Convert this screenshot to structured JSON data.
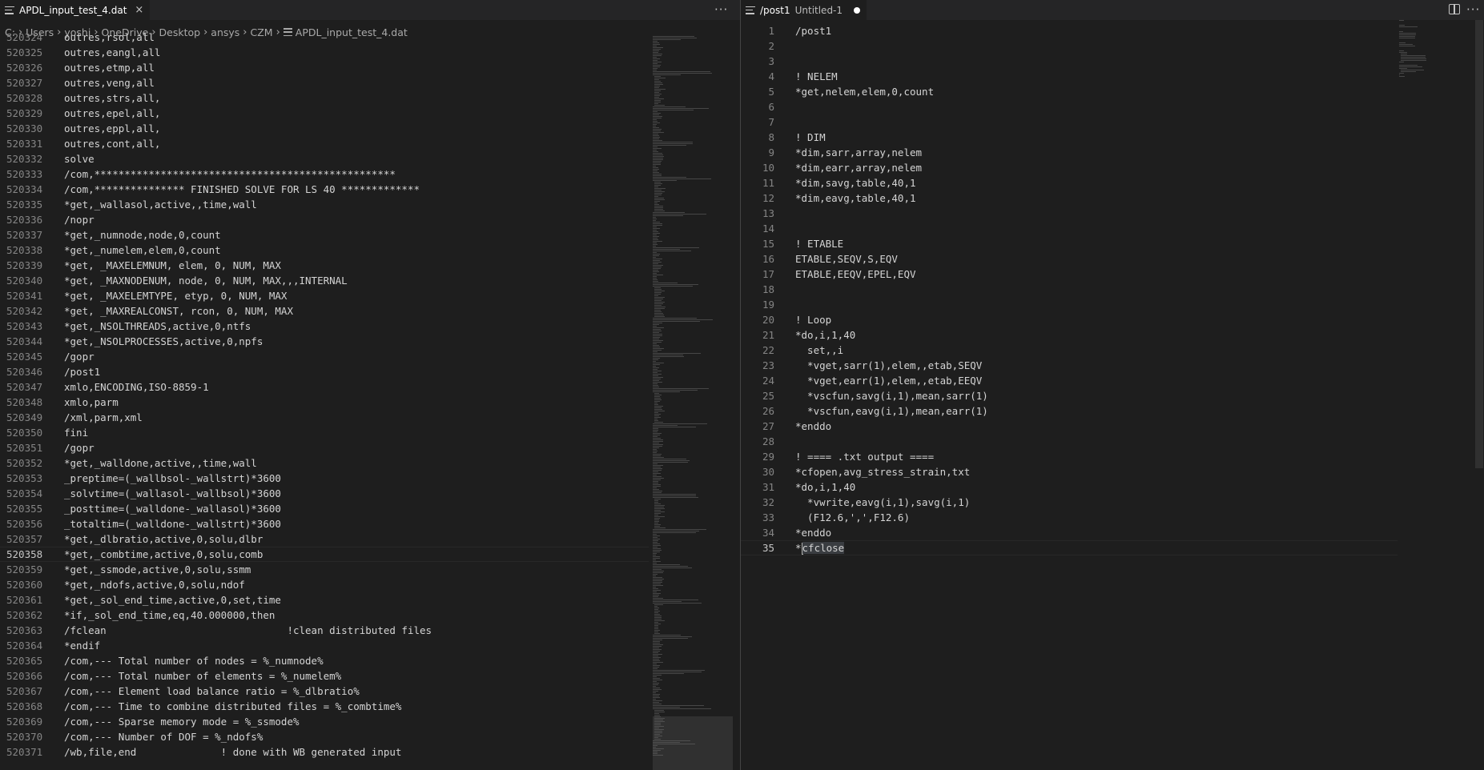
{
  "left": {
    "tab": {
      "title": "APDL_input_test_4.dat",
      "close": "×"
    },
    "more": "···",
    "breadcrumb": [
      "C:",
      "Users",
      "yoshi",
      "OneDrive",
      "Desktop",
      "ansys",
      "CZM",
      "APDL_input_test_4.dat"
    ],
    "lines": [
      {
        "n": "520324",
        "t": "outres,rsol,all"
      },
      {
        "n": "520325",
        "t": "outres,eangl,all"
      },
      {
        "n": "520326",
        "t": "outres,etmp,all"
      },
      {
        "n": "520327",
        "t": "outres,veng,all"
      },
      {
        "n": "520328",
        "t": "outres,strs,all,"
      },
      {
        "n": "520329",
        "t": "outres,epel,all,"
      },
      {
        "n": "520330",
        "t": "outres,eppl,all,"
      },
      {
        "n": "520331",
        "t": "outres,cont,all,"
      },
      {
        "n": "520332",
        "t": "solve"
      },
      {
        "n": "520333",
        "t": "/com,**************************************************"
      },
      {
        "n": "520334",
        "t": "/com,*************** FINISHED SOLVE FOR LS 40 *************"
      },
      {
        "n": "520335",
        "t": "*get,_wallasol,active,,time,wall"
      },
      {
        "n": "520336",
        "t": "/nopr"
      },
      {
        "n": "520337",
        "t": "*get,_numnode,node,0,count"
      },
      {
        "n": "520338",
        "t": "*get,_numelem,elem,0,count"
      },
      {
        "n": "520339",
        "t": "*get, _MAXELEMNUM, elem, 0, NUM, MAX"
      },
      {
        "n": "520340",
        "t": "*get, _MAXNODENUM, node, 0, NUM, MAX,,,INTERNAL"
      },
      {
        "n": "520341",
        "t": "*get, _MAXELEMTYPE, etyp, 0, NUM, MAX"
      },
      {
        "n": "520342",
        "t": "*get, _MAXREALCONST, rcon, 0, NUM, MAX"
      },
      {
        "n": "520343",
        "t": "*get,_NSOLTHREADS,active,0,ntfs"
      },
      {
        "n": "520344",
        "t": "*get,_NSOLPROCESSES,active,0,npfs"
      },
      {
        "n": "520345",
        "t": "/gopr"
      },
      {
        "n": "520346",
        "t": "/post1"
      },
      {
        "n": "520347",
        "t": "xmlo,ENCODING,ISO-8859-1"
      },
      {
        "n": "520348",
        "t": "xmlo,parm"
      },
      {
        "n": "520349",
        "t": "/xml,parm,xml"
      },
      {
        "n": "520350",
        "t": "fini"
      },
      {
        "n": "520351",
        "t": "/gopr"
      },
      {
        "n": "520352",
        "t": "*get,_walldone,active,,time,wall"
      },
      {
        "n": "520353",
        "t": "_preptime=(_wallbsol-_wallstrt)*3600"
      },
      {
        "n": "520354",
        "t": "_solvtime=(_wallasol-_wallbsol)*3600"
      },
      {
        "n": "520355",
        "t": "_posttime=(_walldone-_wallasol)*3600"
      },
      {
        "n": "520356",
        "t": "_totaltim=(_walldone-_wallstrt)*3600"
      },
      {
        "n": "520357",
        "t": "*get,_dlbratio,active,0,solu,dlbr"
      },
      {
        "n": "520358",
        "t": "*get,_combtime,active,0,solu,comb"
      },
      {
        "n": "520359",
        "t": "*get,_ssmode,active,0,solu,ssmm"
      },
      {
        "n": "520360",
        "t": "*get,_ndofs,active,0,solu,ndof"
      },
      {
        "n": "520361",
        "t": "*get,_sol_end_time,active,0,set,time"
      },
      {
        "n": "520362",
        "t": "*if,_sol_end_time,eq,40.000000,then"
      },
      {
        "n": "520363",
        "t": "/fclean                              !clean distributed files"
      },
      {
        "n": "520364",
        "t": "*endif"
      },
      {
        "n": "520365",
        "t": "/com,--- Total number of nodes = %_numnode%"
      },
      {
        "n": "520366",
        "t": "/com,--- Total number of elements = %_numelem%"
      },
      {
        "n": "520367",
        "t": "/com,--- Element load balance ratio = %_dlbratio%"
      },
      {
        "n": "520368",
        "t": "/com,--- Time to combine distributed files = %_combtime%"
      },
      {
        "n": "520369",
        "t": "/com,--- Sparse memory mode = %_ssmode%"
      },
      {
        "n": "520370",
        "t": "/com,--- Number of DOF = %_ndofs%"
      },
      {
        "n": "520371",
        "t": "/wb,file,end              ! done with WB generated input"
      }
    ]
  },
  "right": {
    "tab": {
      "title": "/post1",
      "subtitle": "Untitled-1"
    },
    "more": "···",
    "lines": [
      {
        "n": "1",
        "t": "/post1"
      },
      {
        "n": "2",
        "t": ""
      },
      {
        "n": "3",
        "t": ""
      },
      {
        "n": "4",
        "t": "! NELEM"
      },
      {
        "n": "5",
        "t": "*get,nelem,elem,0,count"
      },
      {
        "n": "6",
        "t": ""
      },
      {
        "n": "7",
        "t": ""
      },
      {
        "n": "8",
        "t": "! DIM"
      },
      {
        "n": "9",
        "t": "*dim,sarr,array,nelem"
      },
      {
        "n": "10",
        "t": "*dim,earr,array,nelem"
      },
      {
        "n": "11",
        "t": "*dim,savg,table,40,1"
      },
      {
        "n": "12",
        "t": "*dim,eavg,table,40,1"
      },
      {
        "n": "13",
        "t": ""
      },
      {
        "n": "14",
        "t": ""
      },
      {
        "n": "15",
        "t": "! ETABLE"
      },
      {
        "n": "16",
        "t": "ETABLE,SEQV,S,EQV"
      },
      {
        "n": "17",
        "t": "ETABLE,EEQV,EPEL,EQV"
      },
      {
        "n": "18",
        "t": ""
      },
      {
        "n": "19",
        "t": ""
      },
      {
        "n": "20",
        "t": "! Loop"
      },
      {
        "n": "21",
        "t": "*do,i,1,40"
      },
      {
        "n": "22",
        "t": "  set,,i"
      },
      {
        "n": "23",
        "t": "  *vget,sarr(1),elem,,etab,SEQV"
      },
      {
        "n": "24",
        "t": "  *vget,earr(1),elem,,etab,EEQV"
      },
      {
        "n": "25",
        "t": "  *vscfun,savg(i,1),mean,sarr(1)"
      },
      {
        "n": "26",
        "t": "  *vscfun,eavg(i,1),mean,earr(1)"
      },
      {
        "n": "27",
        "t": "*enddo"
      },
      {
        "n": "28",
        "t": ""
      },
      {
        "n": "29",
        "t": "! ==== .txt output ===="
      },
      {
        "n": "30",
        "t": "*cfopen,avg_stress_strain,txt"
      },
      {
        "n": "31",
        "t": "*do,i,1,40"
      },
      {
        "n": "32",
        "t": "  *vwrite,eavg(i,1),savg(i,1)"
      },
      {
        "n": "33",
        "t": "  (F12.6,',',F12.6)"
      },
      {
        "n": "34",
        "t": "*enddo"
      },
      {
        "n": "35a",
        "t": "*"
      },
      {
        "n": "35b",
        "t": "cfclose"
      }
    ],
    "last_line_number": "35"
  }
}
